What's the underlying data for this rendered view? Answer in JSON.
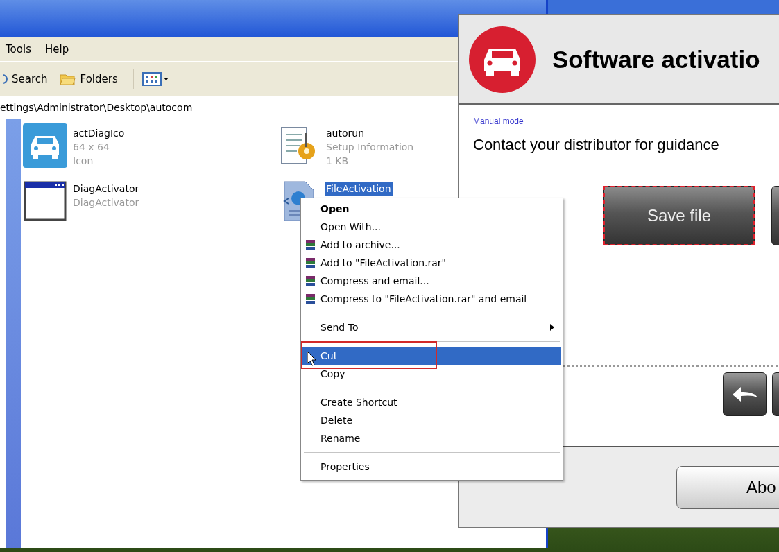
{
  "explorer": {
    "menu": [
      "Tools",
      "Help"
    ],
    "toolbar": [
      {
        "label": "Search",
        "kind": "search"
      },
      {
        "label": "Folders",
        "kind": "folders"
      },
      {
        "kind": "views"
      }
    ],
    "address": "ettings\\Administrator\\Desktop\\autocom",
    "files": [
      {
        "name": "actDiagIco",
        "details": [
          "64 x 64",
          "Icon"
        ],
        "kind": "car",
        "selected": false
      },
      {
        "name": "autorun",
        "details": [
          "Setup Information",
          "1 KB"
        ],
        "kind": "setup",
        "selected": false
      },
      {
        "name": "DiagActivator",
        "details": [
          "DiagActivator"
        ],
        "kind": "window",
        "selected": false
      },
      {
        "name": "FileActivation",
        "kind": "xml",
        "selected": true
      }
    ]
  },
  "context_menu": [
    {
      "label": "Open",
      "kind": "default",
      "selected": false,
      "marked": false
    },
    {
      "label": "Open With...",
      "kind": "normal",
      "selected": false,
      "marked": false
    },
    {
      "label": "Add to archive...",
      "kind": "archive",
      "selected": false,
      "marked": false
    },
    {
      "label": "Add to \"FileActivation.rar\"",
      "kind": "archive",
      "selected": false,
      "marked": false
    },
    {
      "label": "Compress and email...",
      "kind": "archive",
      "selected": false,
      "marked": false
    },
    {
      "label": "Compress to \"FileActivation.rar\" and email",
      "kind": "archive",
      "selected": false,
      "marked": false
    },
    {
      "kind": "separator"
    },
    {
      "label": "Send To",
      "kind": "submenu",
      "selected": false,
      "marked": false
    },
    {
      "kind": "separator"
    },
    {
      "label": "Cut",
      "kind": "normal",
      "selected": true,
      "marked": true
    },
    {
      "label": "Copy",
      "kind": "normal",
      "selected": false,
      "marked": false
    },
    {
      "kind": "separator"
    },
    {
      "label": "Create Shortcut",
      "kind": "normal",
      "selected": false,
      "marked": false
    },
    {
      "label": "Delete",
      "kind": "normal",
      "selected": false,
      "marked": false
    },
    {
      "label": "Rename",
      "kind": "normal",
      "selected": false,
      "marked": false
    },
    {
      "kind": "separator"
    },
    {
      "label": "Properties",
      "kind": "normal",
      "selected": false,
      "marked": false
    }
  ],
  "activation": {
    "title": "Software activatio",
    "mode_link": "Manual mode",
    "message": "Contact your distributor for guidance",
    "save_button": {
      "label": "Save file",
      "focused": true
    },
    "footer_button": "Abo"
  }
}
